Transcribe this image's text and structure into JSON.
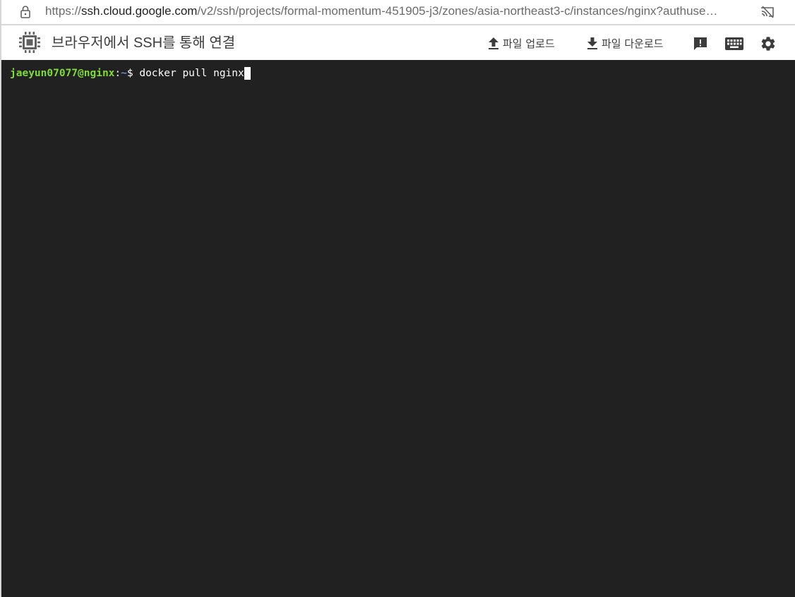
{
  "address_bar": {
    "url_prefix": "https://",
    "url_host": "ssh.cloud.google.com",
    "url_path": "/v2/ssh/projects/formal-momentum-451905-j3/zones/asia-northeast3-c/instances/nginx?authuse…",
    "lock_icon": "lock-icon",
    "cast_icon": "cast-off-icon"
  },
  "toolbar": {
    "title": "브라우저에서 SSH를 통해 연결",
    "upload_label": "파일 업로드",
    "download_label": "파일 다운로드",
    "icons": [
      "chip-icon",
      "upload-icon",
      "download-icon",
      "feedback-icon",
      "keyboard-icon",
      "gear-icon"
    ]
  },
  "terminal": {
    "prompt_user_host": "jaeyun07077@nginx",
    "prompt_colon": ":",
    "prompt_path": "~",
    "prompt_symbol": "$ ",
    "command": "docker pull nginx"
  },
  "colors": {
    "terminal_bg": "#212121",
    "prompt_user": "#7ddb3a",
    "toolbar_icon": "#3c3c3c"
  }
}
